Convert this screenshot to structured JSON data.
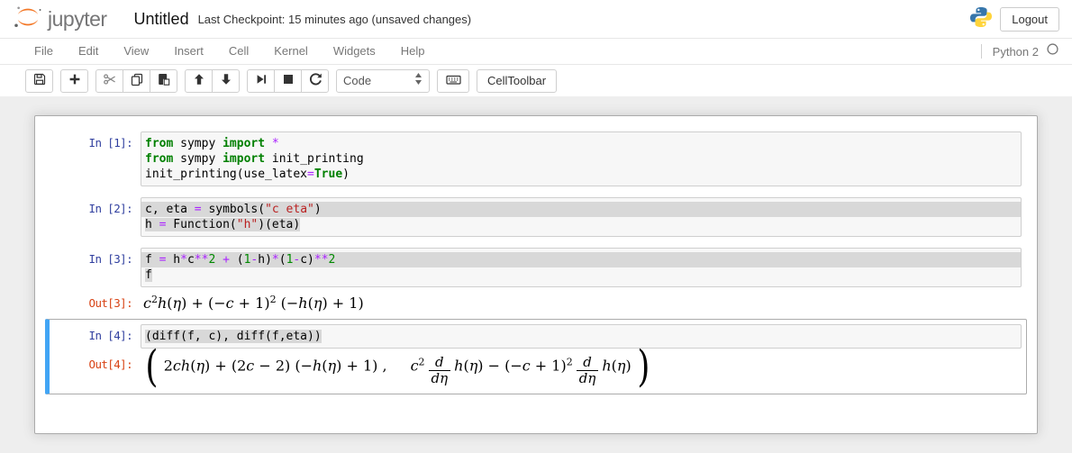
{
  "header": {
    "logo_text": "jupyter",
    "title": "Untitled",
    "checkpoint": "Last Checkpoint: 15 minutes ago (unsaved changes)",
    "logout_label": "Logout"
  },
  "menubar": {
    "items": [
      "File",
      "Edit",
      "View",
      "Insert",
      "Cell",
      "Kernel",
      "Widgets",
      "Help"
    ],
    "kernel_name": "Python 2",
    "kernel_status": "idle"
  },
  "toolbar": {
    "groups": [
      [
        "save"
      ],
      [
        "add-cell"
      ],
      [
        "cut",
        "copy",
        "paste"
      ],
      [
        "move-up",
        "move-down"
      ],
      [
        "run",
        "interrupt",
        "restart"
      ]
    ],
    "celltype_value": "Code",
    "celltoolbar_label": "CellToolbar"
  },
  "colors": {
    "accent_orange": "#F37726",
    "prompt_in": "#303F9F",
    "prompt_out": "#D84315",
    "keyword_green": "#008000",
    "operator_purple": "#AA22FF",
    "string_red": "#BA2121",
    "selected_cell_bar": "#42A5F5"
  },
  "notebook": {
    "cells": [
      {
        "kind": "code",
        "selected": false,
        "in_prompt": "In [1]:",
        "source": [
          {
            "hl": "none",
            "tokens": [
              [
                "kw",
                "from"
              ],
              [
                "pl",
                " sympy "
              ],
              [
                "kw",
                "import"
              ],
              [
                "pl",
                " "
              ],
              [
                "op",
                "*"
              ]
            ]
          },
          {
            "hl": "none",
            "tokens": [
              [
                "kw",
                "from"
              ],
              [
                "pl",
                " sympy "
              ],
              [
                "kw",
                "import"
              ],
              [
                "pl",
                " init_printing"
              ]
            ]
          },
          {
            "hl": "none",
            "tokens": [
              [
                "pl",
                "init_printing(use_latex"
              ],
              [
                "op",
                "="
              ],
              [
                "kw",
                "True"
              ],
              [
                "pl",
                ")"
              ]
            ]
          }
        ]
      },
      {
        "kind": "code",
        "selected": false,
        "in_prompt": "In [2]:",
        "source": [
          {
            "hl": "full",
            "tokens": [
              [
                "pl",
                "c, eta "
              ],
              [
                "op",
                "="
              ],
              [
                "pl",
                " symbols("
              ],
              [
                "str",
                "\"c eta\""
              ],
              [
                "pl",
                ")"
              ]
            ]
          },
          {
            "hl": "text",
            "tokens": [
              [
                "pl",
                "h "
              ],
              [
                "op",
                "="
              ],
              [
                "pl",
                " Function("
              ],
              [
                "str",
                "\"h\""
              ],
              [
                "pl",
                ")(eta)"
              ]
            ]
          }
        ]
      },
      {
        "kind": "code",
        "selected": false,
        "in_prompt": "In [3]:",
        "source": [
          {
            "hl": "full",
            "tokens": [
              [
                "pl",
                "f "
              ],
              [
                "op",
                "="
              ],
              [
                "pl",
                " h"
              ],
              [
                "op",
                "*"
              ],
              [
                "pl",
                "c"
              ],
              [
                "op",
                "**"
              ],
              [
                "num",
                "2"
              ],
              [
                "pl",
                " "
              ],
              [
                "op",
                "+"
              ],
              [
                "pl",
                " ("
              ],
              [
                "num",
                "1"
              ],
              [
                "op",
                "-"
              ],
              [
                "pl",
                "h)"
              ],
              [
                "op",
                "*"
              ],
              [
                "pl",
                "("
              ],
              [
                "num",
                "1"
              ],
              [
                "op",
                "-"
              ],
              [
                "pl",
                "c)"
              ],
              [
                "op",
                "**"
              ],
              [
                "num",
                "2"
              ]
            ]
          },
          {
            "hl": "text",
            "tokens": [
              [
                "pl",
                "f"
              ]
            ]
          }
        ],
        "out_prompt": "Out[3]:",
        "output_math": [
          {
            "txt": "c"
          },
          {
            "sup": "2"
          },
          {
            "txt": "h(η) + (−c + 1)"
          },
          {
            "sup": "2"
          },
          {
            "txt": " (−h(η) + 1)"
          }
        ]
      },
      {
        "kind": "code",
        "selected": true,
        "in_prompt": "In [4]:",
        "source": [
          {
            "hl": "text",
            "tokens": [
              [
                "pl",
                "(diff(f, c), diff(f,eta))"
              ]
            ]
          }
        ],
        "out_prompt": "Out[4]:",
        "output_math": [
          {
            "big": "("
          },
          {
            "sp": 4
          },
          {
            "txt": "2ch(η) + (2c − 2) (−h(η) + 1) ,"
          },
          {
            "sp": 26
          },
          {
            "txt": "c"
          },
          {
            "sup": "2"
          },
          {
            "frac": [
              "d",
              "dη"
            ]
          },
          {
            "txt": "h(η) − (−c + 1)"
          },
          {
            "sup": "2"
          },
          {
            "frac": [
              "d",
              "dη"
            ]
          },
          {
            "txt": "h(η)"
          },
          {
            "sp": 4
          },
          {
            "big": ")"
          }
        ]
      }
    ]
  }
}
